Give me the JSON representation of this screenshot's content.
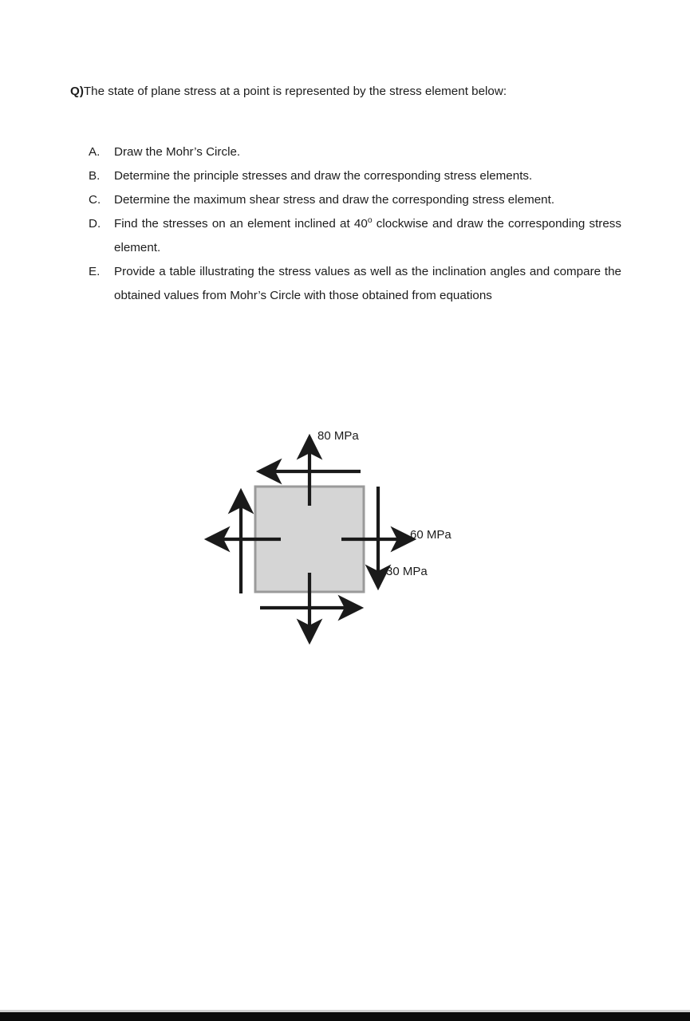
{
  "document": {
    "question": {
      "label": "Q)",
      "text": "The state of plane stress at a point is represented by the stress element below:"
    },
    "tasks": [
      {
        "marker": "A.",
        "text": "Draw the Mohr’s Circle."
      },
      {
        "marker": "B.",
        "text": "Determine the principle stresses and draw the corresponding stress elements."
      },
      {
        "marker": "C.",
        "text": "Determine the maximum shear stress and draw the corresponding stress element."
      },
      {
        "marker": "D.",
        "text_before": "Find the stresses on an element inclined at 40",
        "degree": "o",
        "text_after": " clockwise and draw the corresponding stress element."
      },
      {
        "marker": "E.",
        "text": "Provide a table illustrating the stress values as well as the inclination angles and compare the obtained values from Mohr’s Circle with those obtained from equations"
      }
    ],
    "figure": {
      "name": "plane-stress-element",
      "labels": {
        "sigma_y": "80 MPa",
        "sigma_x": "60 MPa",
        "tau_xy": "30 MPa"
      },
      "colors": {
        "element_fill": "#d5d5d5",
        "element_stroke": "#9a9a9a",
        "arrow": "#1a1a1a"
      },
      "values": {
        "sigma_y_MPa": 80,
        "sigma_x_MPa": 60,
        "tau_xy_MPa": 30,
        "inclination_deg": 40,
        "inclination_sense": "clockwise"
      }
    }
  }
}
